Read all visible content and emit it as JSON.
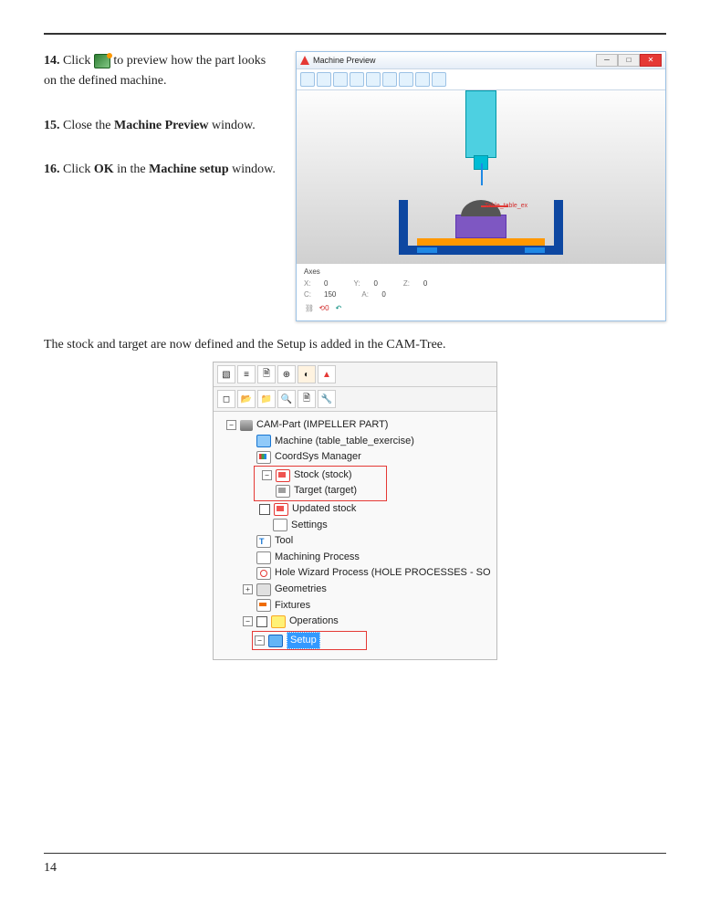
{
  "steps": {
    "s14_num": "14.",
    "s14_a": "Click",
    "s14_b": "to preview how the part looks on the defined machine.",
    "s15_num": "15.",
    "s15_a": "Close the",
    "s15_bold": "Machine Preview",
    "s15_b": "window.",
    "s16_num": "16.",
    "s16_a": "Click",
    "s16_bold1": "OK",
    "s16_b": "in the",
    "s16_bold2": "Machine setup",
    "s16_c": "window."
  },
  "summary": "The stock and target are now defined and the Setup is added in the CAM-Tree.",
  "page_number": "14",
  "machine_preview": {
    "title": "Machine Preview",
    "axes_title": "Axes",
    "x_label": "X:",
    "x_val": "0",
    "y_label": "Y:",
    "y_val": "0",
    "z_label": "Z:",
    "z_val": "0",
    "c_label": "C:",
    "c_val": "150",
    "a_label": "A:",
    "a_val": "0",
    "table_label": "Table_table_ex"
  },
  "tree": {
    "root": "CAM-Part (IMPELLER PART)",
    "machine": "Machine (table_table_exercise)",
    "coord": "CoordSys Manager",
    "stock": "Stock (stock)",
    "target": "Target (target)",
    "updated": "Updated stock",
    "settings": "Settings",
    "tool": "Tool",
    "proc": "Machining Process",
    "hole": "Hole Wizard Process (HOLE PROCESSES - SO",
    "geom": "Geometries",
    "fix": "Fixtures",
    "ops": "Operations",
    "setup": "Setup"
  }
}
